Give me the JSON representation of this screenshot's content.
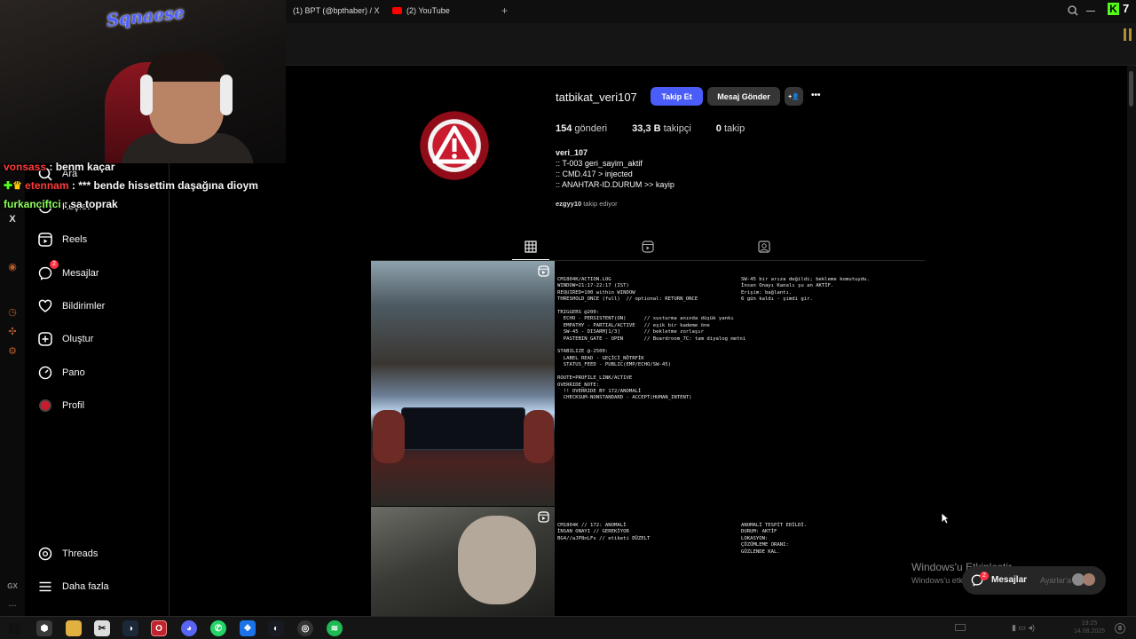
{
  "overlay": {
    "channel_logo": "Sqnaese",
    "chat": [
      {
        "user": "vonsass",
        "message": " : benm kaçar",
        "color": "#ff3b3b"
      },
      {
        "user": "etennam",
        "message": " : *** bende hissettim daşağına dioym",
        "color": "#ff3b3b"
      },
      {
        "user": "furkanciftci",
        "message": " : sa toprak",
        "color": "#8cff5a"
      }
    ]
  },
  "browser": {
    "tabs": [
      {
        "label": "(1) BPT (@bpthaber) / X"
      },
      {
        "label": "(2) YouTube"
      }
    ],
    "new_tab": "+",
    "kick_count": "7"
  },
  "sidebar": {
    "items": [
      {
        "label": "Ara",
        "icon": "search-icon"
      },
      {
        "label": "Keşfet",
        "icon": "compass-icon"
      },
      {
        "label": "Reels",
        "icon": "reels-icon"
      },
      {
        "label": "Mesajlar",
        "icon": "messenger-icon",
        "badge": "2"
      },
      {
        "label": "Bildirimler",
        "icon": "heart-icon"
      },
      {
        "label": "Oluştur",
        "icon": "plus-square-icon"
      },
      {
        "label": "Pano",
        "icon": "dashboard-icon"
      },
      {
        "label": "Profil",
        "icon": "avatar-icon"
      }
    ],
    "bottom": [
      {
        "label": "Threads",
        "icon": "threads-icon"
      },
      {
        "label": "Daha fazla",
        "icon": "menu-icon"
      }
    ],
    "rail_icons": [
      "x-icon",
      "youtube-icon",
      "history-icon",
      "puzzle-icon",
      "settings-icon"
    ],
    "rail_x": "X",
    "rail_gx": "GX",
    "rail_more": "..."
  },
  "profile": {
    "username": "tatbikat_veri107",
    "follow_button": "Takip Et",
    "message_button": "Mesaj Gönder",
    "add_person_icon": "+👤",
    "more": "•••",
    "stats": {
      "posts_num": "154",
      "posts_label": "gönderi",
      "followers_num": "33,3 B",
      "followers_label": "takipçi",
      "following_num": "0",
      "following_label": "takip"
    },
    "name": "veri_107",
    "bio": [
      ":: T-003 geri_sayim_aktif",
      ":: CMD.417 > injected",
      ":: ANAHTAR-ID.DURUM >> kayip"
    ],
    "followed_by_user": "ezgyy10",
    "followed_by_text": " takip ediyor"
  },
  "posts": {
    "post1_left": "CM1804K/ACTION.LOG\nWINDOW=21:17-22:17 (IST)\nREQUIRED=100 within WINDOW\nTHRESHOLD_ONCE (full)  // optional: RETURN_ONCE\n\nTRIGGERS @200:\n  ECHO - PERSISTENT(ON)      // susturma anında düşük yankı\n  EMPATHY - PARTIAL/ACTIVE   // eşik bir kademe öne\n  SW-45 - DISARM[1/3]        // bekletme zorlaşır\n  PASTEBIN_GATE - OPEN       // Boardroom_7C: tam diyalog metni\n\nSTABILIZE @-2500:\n  LABEL READ - GEÇİCİ_NÖTRFİK\n  STATUS_FEED - PUBLIC(EMP/ECHO/SW-45)\n\nROUTE=PROFILE_LINK/ACTIVE\nOVERRIDE_NOTE:\n  !! OVERRIDE BY 172/ANOMALİ\n  CHECKSUM-NONSTANDARD - ACCEPT(HUMAN_INTENT)",
    "post1_right": "SW-45 bir arıza değildi; bekleme komutuydu.\nİnsan Onayı Kanalı şu an AKTİF.\nErişim: bağlantı.\n6 gün kaldı - şimdi gir.",
    "post2_left": "CM1804K // 172: ANOMALİ\nİNSAN ONAYI // GEREKİYOR\nBG4//aJP8nLFs // etiketi DÜZELT",
    "post2_right": "ANOMALİ TESPİT EDİLDİ.\nDURUM: AKTİF\nLOKASYON:\nÇÖZÜMLEME ORANI:\nGÜZLENDE KAL."
  },
  "system": {
    "watermark_title": "Windows'u Etkinleştir",
    "watermark_sub": "Windows'u etk...",
    "watermark_tail": "Ayarlar'a gi",
    "toast_label": "Mesajlar",
    "toast_badge": "2",
    "clock_time": "19:25",
    "clock_date": "14.08.2025",
    "notif_count": "8"
  }
}
